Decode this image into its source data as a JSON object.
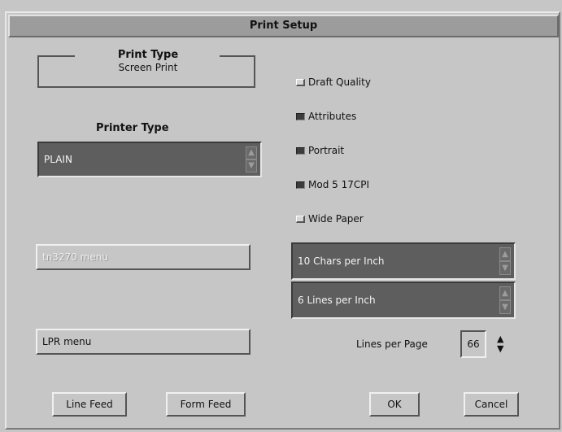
{
  "window": {
    "title": "Print Setup"
  },
  "print_type": {
    "label": "Print Type",
    "value": "Screen Print"
  },
  "printer_type": {
    "label": "Printer Type",
    "selected": "PLAIN"
  },
  "menus": {
    "tn3270_menu": "tn3270 menu",
    "lpr_menu": "LPR menu"
  },
  "options": [
    {
      "label": "Draft Quality",
      "checked": false
    },
    {
      "label": "Attributes",
      "checked": true
    },
    {
      "label": "Portrait",
      "checked": true
    },
    {
      "label": "Mod 5 17CPI",
      "checked": true
    },
    {
      "label": "Wide Paper",
      "checked": false
    }
  ],
  "chars_per_inch": "10 Chars per Inch",
  "lines_per_inch": "6 Lines per Inch",
  "lines_per_page": {
    "label": "Lines per Page",
    "value": "66"
  },
  "buttons": {
    "line_feed": "Line Feed",
    "form_feed": "Form Feed",
    "ok": "OK",
    "cancel": "Cancel"
  },
  "icons": [
    "up-arrow-icon",
    "down-arrow-icon"
  ]
}
